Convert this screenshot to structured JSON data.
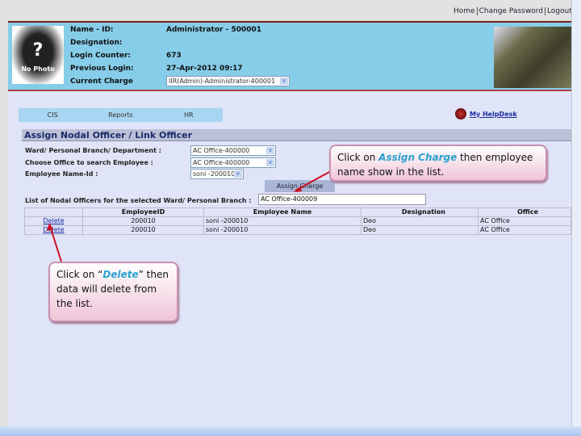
{
  "top_links": [
    "Home",
    "Change Password",
    "Logout"
  ],
  "header": {
    "photo_text": "No Photo",
    "photo_glyph": "?",
    "fields": [
      {
        "label": "Name - ID:",
        "value": "Administrator - 500001"
      },
      {
        "label": "Designation:",
        "value": ""
      },
      {
        "label": "Login Counter:",
        "value": "673"
      },
      {
        "label": "Previous Login:",
        "value": "27-Apr-2012 09:17"
      },
      {
        "label": "Current Charge",
        "value": "IIR(Admin)-Administrator-400001"
      }
    ]
  },
  "nav": [
    "CIS",
    "Reports",
    "HR"
  ],
  "helpdesk": "My HelpDesk",
  "page_title": "Assign Nodal Officer / Link Officer",
  "form": {
    "ward_label": "Ward/ Personal Branch/ Department :",
    "ward_value": "AC Office-400000",
    "office_label": "Choose Office to search Employee :",
    "office_value": "AC Office-400000",
    "employee_label": "Employee Name-Id :",
    "employee_value": "soni -200010",
    "assign_button": "Assign Charge",
    "list_label": "List of Nodal Officers for the selected Ward/ Personal Branch :",
    "list_value": "AC Office-400009"
  },
  "table": {
    "headers": [
      "",
      "EmployeeID",
      "Employee Name",
      "Designation",
      "Office"
    ],
    "rows": [
      [
        "Delete",
        "200010",
        "soni -200010",
        "Deo",
        "AC Office"
      ],
      [
        "Delete",
        "200010",
        "soni -200010",
        "Deo",
        "AC Office"
      ]
    ]
  },
  "callouts": {
    "assign": {
      "pre": "Click on ",
      "em": "Assign Charge",
      "post": " then employee name show in the list."
    },
    "delete": {
      "pre": "Click on “",
      "em": "Delete",
      "post": "” then data will delete from the list."
    }
  },
  "colors": {
    "header_bg": "#86cde9",
    "content_bg": "#e0e4f8",
    "callout_accent": "#2aa0d0",
    "arrow": "#cc1122"
  }
}
